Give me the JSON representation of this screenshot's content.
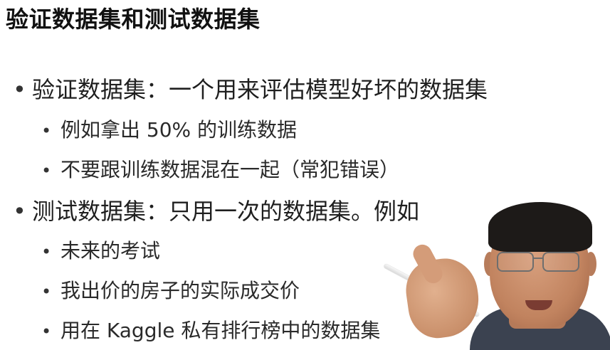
{
  "slide": {
    "title": "验证数据集和测试数据集",
    "bullets": [
      {
        "level": 1,
        "text": "验证数据集：一个用来评估模型好坏的数据集",
        "children": [
          {
            "text": "例如拿出 50% 的训练数据"
          },
          {
            "text": "不要跟训练数据混在一起（常犯错误）"
          }
        ]
      },
      {
        "level": 1,
        "text": "测试数据集：只用一次的数据集。例如",
        "children": [
          {
            "text": "未来的考试"
          },
          {
            "text": "我出价的房子的实际成交价"
          },
          {
            "text": "用在 Kaggle 私有排行榜中的数据集"
          }
        ]
      }
    ],
    "bullet_symbol": "•",
    "sub_bullet_symbol": "•"
  },
  "presenter": {
    "icon": "presenter-video-overlay"
  }
}
